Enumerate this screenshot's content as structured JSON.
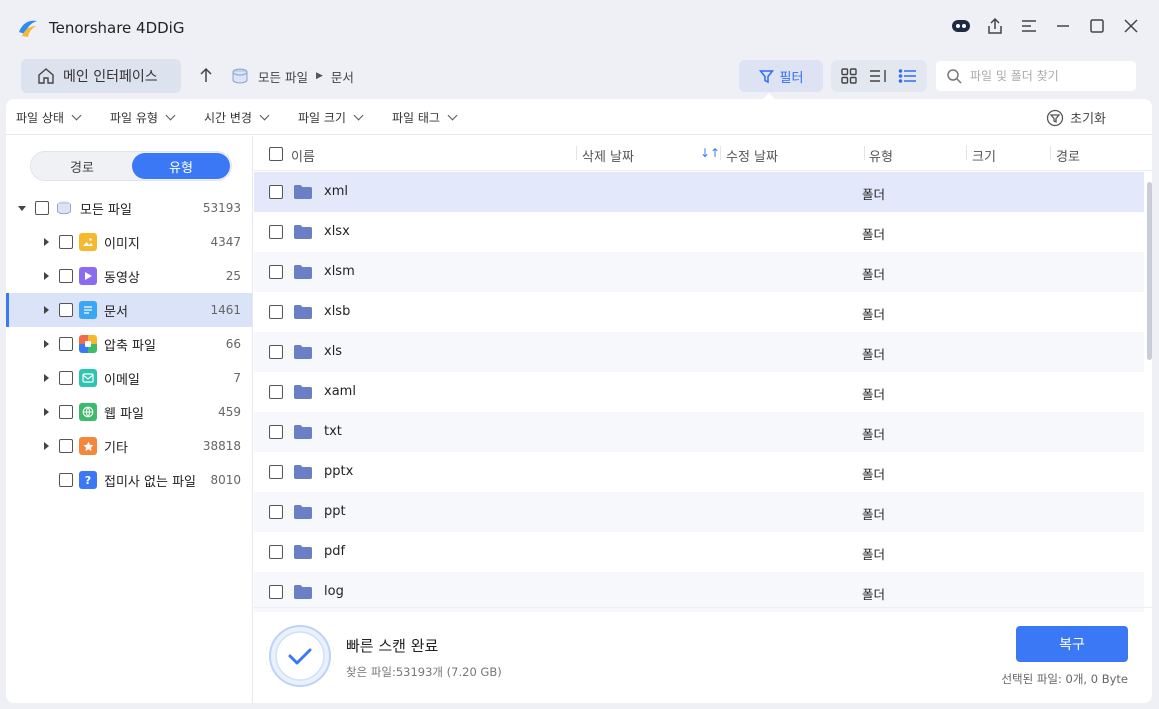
{
  "app": {
    "title": "Tenorshare 4DDiG"
  },
  "toolbar": {
    "home_label": "메인 인터페이스",
    "breadcrumb": [
      "모든 파일",
      "문서"
    ],
    "filter_label": "필터",
    "search_placeholder": "파일 및 폴더 찾기"
  },
  "filterbar": {
    "items": [
      "파일 상태",
      "파일 유형",
      "시간 변경",
      "파일 크기",
      "파일 태그"
    ],
    "reset_label": "초기화"
  },
  "sidebar": {
    "segments": {
      "path": "경로",
      "type": "유형",
      "active": "type"
    },
    "tree": [
      {
        "label": "모든 파일",
        "count": "53193",
        "icon": "all-files-icon",
        "expanded": true
      },
      {
        "label": "이미지",
        "count": "4347",
        "icon": "image-icon",
        "color": "#f5b82e"
      },
      {
        "label": "동영상",
        "count": "25",
        "icon": "video-icon",
        "color": "#8b6cf0"
      },
      {
        "label": "문서",
        "count": "1461",
        "icon": "document-icon",
        "color": "#3ba6f6",
        "selected": true
      },
      {
        "label": "압축 파일",
        "count": "66",
        "icon": "archive-icon",
        "color": "#f06b4a"
      },
      {
        "label": "이메일",
        "count": "7",
        "icon": "email-icon",
        "color": "#2fc4b2"
      },
      {
        "label": "웹 파일",
        "count": "459",
        "icon": "web-icon",
        "color": "#3dbb6b"
      },
      {
        "label": "기타",
        "count": "38818",
        "icon": "other-icon",
        "color": "#f5873a"
      },
      {
        "label": "접미사 없는 파일",
        "count": "8010",
        "icon": "unknown-file-icon",
        "color": "#3b78f6"
      }
    ]
  },
  "table": {
    "columns": [
      "이름",
      "삭제 날짜",
      "수정 날짜",
      "유형",
      "크기",
      "경로"
    ],
    "rows": [
      {
        "name": "xml",
        "type": "폴더"
      },
      {
        "name": "xlsx",
        "type": "폴더"
      },
      {
        "name": "xlsm",
        "type": "폴더"
      },
      {
        "name": "xlsb",
        "type": "폴더"
      },
      {
        "name": "xls",
        "type": "폴더"
      },
      {
        "name": "xaml",
        "type": "폴더"
      },
      {
        "name": "txt",
        "type": "폴더"
      },
      {
        "name": "pptx",
        "type": "폴더"
      },
      {
        "name": "ppt",
        "type": "폴더"
      },
      {
        "name": "pdf",
        "type": "폴더"
      },
      {
        "name": "log",
        "type": "폴더"
      }
    ]
  },
  "status": {
    "title": "빠른 스캔 완료",
    "found": "찾은 파일:53193개 (7.20 GB)",
    "recover_label": "복구",
    "selected": "선택된 파일: 0개, 0 Byte"
  },
  "colors": {
    "accent": "#3b78f6",
    "folder": "#6b7fc4"
  }
}
